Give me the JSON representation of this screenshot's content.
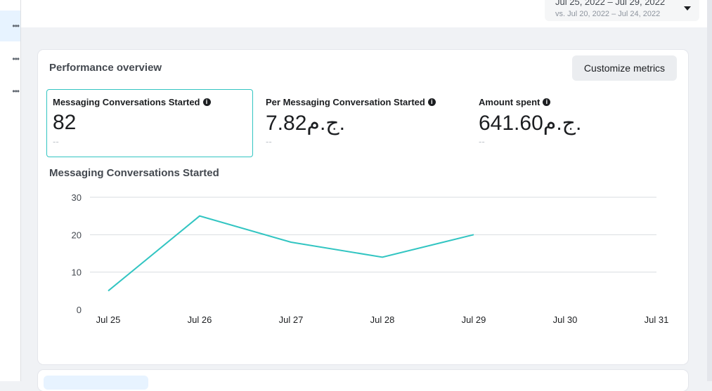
{
  "header": {
    "date_range": "Jul 25, 2022 – Jul 29, 2022",
    "compare_range": "vs. Jul 20, 2022 – Jul 24, 2022"
  },
  "card": {
    "title": "Performance overview",
    "customize_label": "Customize metrics"
  },
  "metrics": [
    {
      "label": "Messaging Conversations Started",
      "value": "82",
      "compare": "--",
      "selected": true
    },
    {
      "label": "Per Messaging Conversation Started",
      "value": "7.82ج.م.",
      "compare": "--",
      "selected": false
    },
    {
      "label": "Amount spent",
      "value": "641.60ج.م.",
      "compare": "--",
      "selected": false
    }
  ],
  "icons": {
    "info": "info-icon",
    "caret": "caret-down-icon",
    "more": "more-dots-icon"
  },
  "colors": {
    "line": "#32c5c2",
    "grid": "#dadde1",
    "selected_border": "#32c5c2"
  },
  "chart_data": {
    "type": "line",
    "title": "Messaging Conversations Started",
    "categories": [
      "Jul 25",
      "Jul 26",
      "Jul 27",
      "Jul 28",
      "Jul 29",
      "Jul 30",
      "Jul 31"
    ],
    "series": [
      {
        "values": [
          5,
          25,
          18,
          14,
          20,
          null,
          null
        ]
      }
    ],
    "yticks": [
      0,
      10,
      20,
      30
    ],
    "ylim": [
      0,
      30
    ],
    "grid": true,
    "xlabel": "",
    "ylabel": ""
  }
}
